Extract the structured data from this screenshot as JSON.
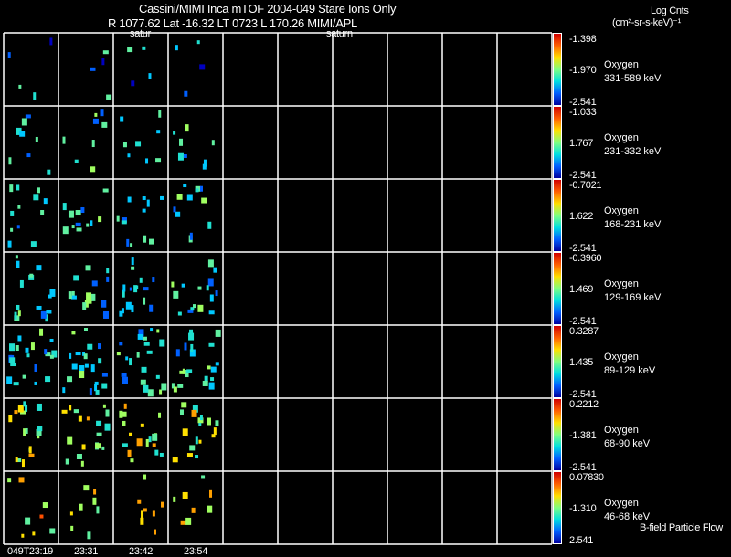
{
  "header": {
    "title": "Cassini/MIMI Inca mTOF  2004-049    Stare    Ions Only",
    "orbit_line": "R         1077.62 Lat -16.32 LT 0723 L           170.26  MIMI/APL",
    "overlay_labels": [
      "satur",
      "saturn"
    ]
  },
  "units": {
    "line1": "Log Cnts",
    "line2": "(cm²-sr-s-keV)⁻¹"
  },
  "footer_note": "B-field Particle Flow",
  "chart_data": {
    "type": "heatmap",
    "x_tick_labels": [
      "049T23:19",
      "23:31",
      "23:42",
      "23:54"
    ],
    "colormap": "rainbow (blue-cyan-green-yellow-red)",
    "panels": [
      {
        "species": "Oxygen",
        "energy": "331-589 keV",
        "cb_max": "-1.398",
        "cb_mid": "-1.970",
        "cb_min": "-2.541"
      },
      {
        "species": "Oxygen",
        "energy": "231-332 keV",
        "cb_max": "-1.033",
        "cb_mid": "1.767",
        "cb_min": "-2.541"
      },
      {
        "species": "Oxygen",
        "energy": "168-231 keV",
        "cb_max": "-0.7021",
        "cb_mid": "1.622",
        "cb_min": "-2.541"
      },
      {
        "species": "Oxygen",
        "energy": "129-169 keV",
        "cb_max": "-0.3960",
        "cb_mid": "1.469",
        "cb_min": "-2.541"
      },
      {
        "species": "Oxygen",
        "energy": "89-129 keV",
        "cb_max": "0.3287",
        "cb_mid": "1.435",
        "cb_min": "-2.541"
      },
      {
        "species": "Oxygen",
        "energy": "68-90 keV",
        "cb_max": "0.2212",
        "cb_mid": "-1.381",
        "cb_min": "-2.541"
      },
      {
        "species": "Oxygen",
        "energy": "46-68 keV",
        "cb_max": "0.07830",
        "cb_mid": "-1.310",
        "cb_min": "2.541"
      }
    ]
  }
}
